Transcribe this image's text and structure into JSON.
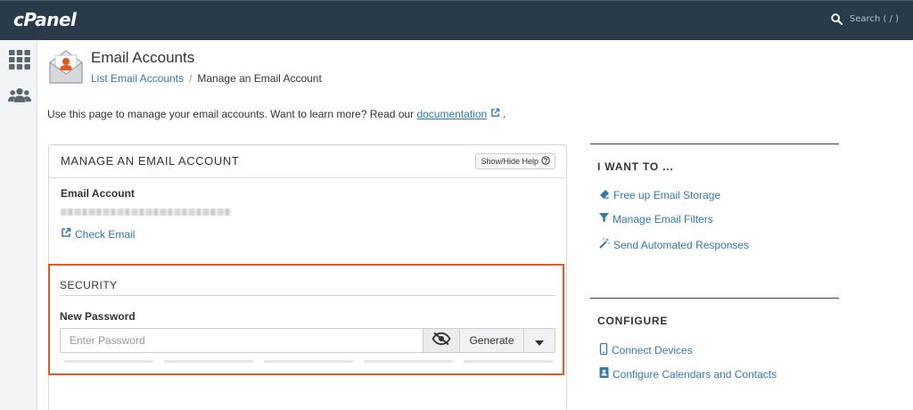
{
  "app": {
    "logo": "cPanel"
  },
  "search": {
    "placeholder": "Search ( / )"
  },
  "sidebar": {
    "items": [
      {
        "icon": "grid-icon"
      },
      {
        "icon": "users-icon"
      }
    ]
  },
  "header": {
    "title": "Email Accounts",
    "breadcrumb": {
      "parent": "List Email Accounts",
      "separator": "/",
      "current": "Manage an Email Account"
    }
  },
  "intro": {
    "text": "Use this page to manage your email accounts. Want to learn more? Read our",
    "link": "documentation",
    "suffix": "."
  },
  "panel": {
    "title": "MANAGE AN EMAIL ACCOUNT",
    "help_button": "Show/Hide Help",
    "email_account_label": "Email Account",
    "check_email": "Check Email"
  },
  "security": {
    "title": "SECURITY",
    "new_password_label": "New Password",
    "password_placeholder": "Enter Password",
    "generate": "Generate",
    "strength_segments": 5
  },
  "aside": {
    "i_want_to": {
      "title": "I WANT TO ...",
      "links": [
        "Free up Email Storage",
        "Manage Email Filters",
        "Send Automated Responses"
      ]
    },
    "configure": {
      "title": "CONFIGURE",
      "links": [
        "Connect Devices",
        "Configure Calendars and Contacts"
      ]
    }
  },
  "colors": {
    "topbar": "#293a4a",
    "link": "#2f79b9",
    "highlight": "#e8581c"
  }
}
